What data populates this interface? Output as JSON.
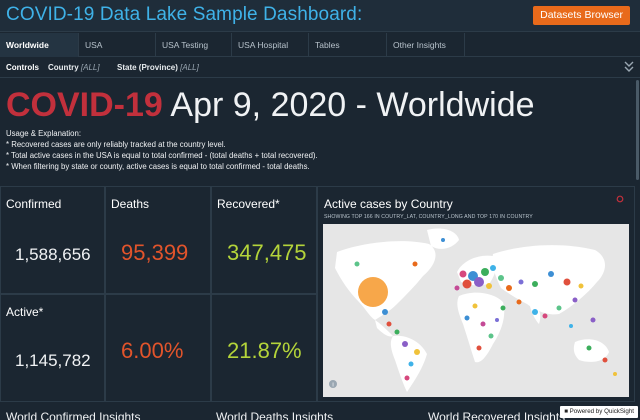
{
  "header": {
    "title": "COVID-19 Data Lake Sample Dashboard:",
    "datasets_button": "Datasets Browser"
  },
  "tabs": [
    {
      "label": "Worldwide"
    },
    {
      "label": "USA"
    },
    {
      "label": "USA Testing"
    },
    {
      "label": "USA Hospital"
    },
    {
      "label": "Tables"
    },
    {
      "label": "Other Insights"
    }
  ],
  "controls": {
    "label": "Controls",
    "country_label": "Country",
    "country_value": "[ALL]",
    "state_label": "State (Province)",
    "state_value": "[ALL]"
  },
  "headline": {
    "covid": "COVID-19",
    "date": "Apr 9, 2020 - Worldwide"
  },
  "usage": {
    "title": "Usage & Explanation:",
    "lines": [
      "* Recovered cases are only reliably tracked at the country level.",
      "* Total active cases in the USA is equal to total confirmed - (total deaths + total recovered).",
      "* When filtering by state or county, active cases is equal to total confirmed - total deaths."
    ]
  },
  "kpis": {
    "confirmed_label": "Confirmed",
    "confirmed_value": "1,588,656",
    "deaths_label": "Deaths",
    "deaths_value": "95,399",
    "recovered_label": "Recovered*",
    "recovered_value": "347,475",
    "active_label": "Active*",
    "active_value": "1,145,782",
    "death_rate": "6.00%",
    "recovery_rate": "21.87%"
  },
  "map": {
    "title": "Active cases by Country",
    "subtitle": "SHOWING TOP 166 IN COUTRY_LAT, COUNTRY_LONG AND TOP 170 IN COUNTRY",
    "info": "i"
  },
  "bottom": {
    "confirmed_insights": "World Confirmed Insights",
    "deaths_insights": "World Deaths Insights",
    "recovered_insights": "World Recovered Insights"
  },
  "footer": {
    "powered": "Powered by QuickSight"
  },
  "colors": {
    "accent_blue": "#3fb2e8",
    "orange": "#e86a1b",
    "covid_red": "#c2303c",
    "deaths_orange": "#e2542b",
    "recovered_green": "#b4d43a"
  }
}
